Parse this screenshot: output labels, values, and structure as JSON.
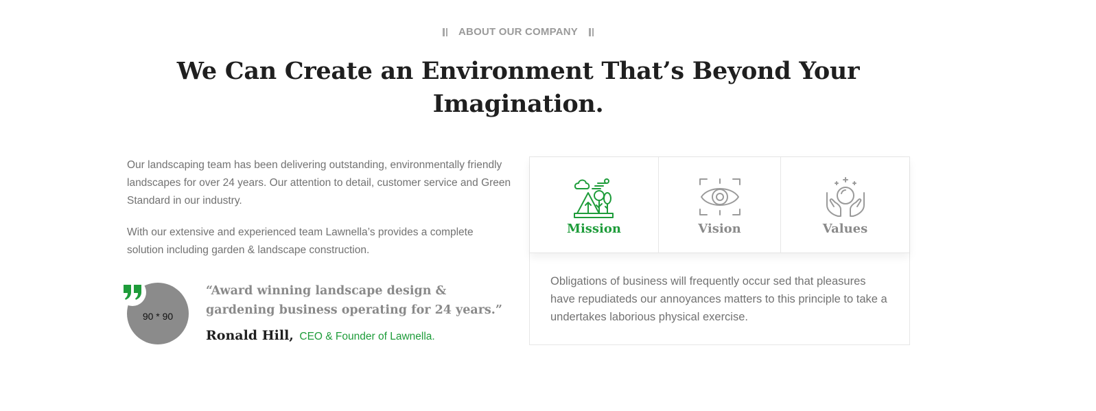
{
  "section": {
    "eyebrow": "ABOUT OUR COMPANY",
    "headline_line1": "We Can Create an Environment That’s Beyond Your",
    "headline_line2": "Imagination."
  },
  "intro": {
    "paragraph1": "Our landscaping team has been delivering outstanding, environmentally friendly landscapes for over 24 years. Our attention to detail, customer service and Green Standard in our industry.",
    "paragraph2": "With our extensive and experienced team Lawnella’s provides a complete solution including garden & landscape construction."
  },
  "testimonial": {
    "avatar_placeholder": "90 * 90",
    "quote_icon": "quote-icon",
    "quote": "“Award winning landscape design & gardening business operating for 24 years.”",
    "author_name": "Ronald Hill,",
    "author_role": "CEO & Founder of Lawnella."
  },
  "tabs": [
    {
      "label": "Mission",
      "icon": "landscape-icon",
      "active": true
    },
    {
      "label": "Vision",
      "icon": "eye-icon",
      "active": false
    },
    {
      "label": "Values",
      "icon": "hands-icon",
      "active": false
    }
  ],
  "tab_content": "Obligations of business will frequently occur sed that pleasures have repudiateds our annoyances matters to this principle to take a undertakes laborious physical exercise.",
  "colors": {
    "accent": "#1e9c3a",
    "heading": "#1f1f1f",
    "muted": "#8a8a8a",
    "body": "#727272"
  }
}
